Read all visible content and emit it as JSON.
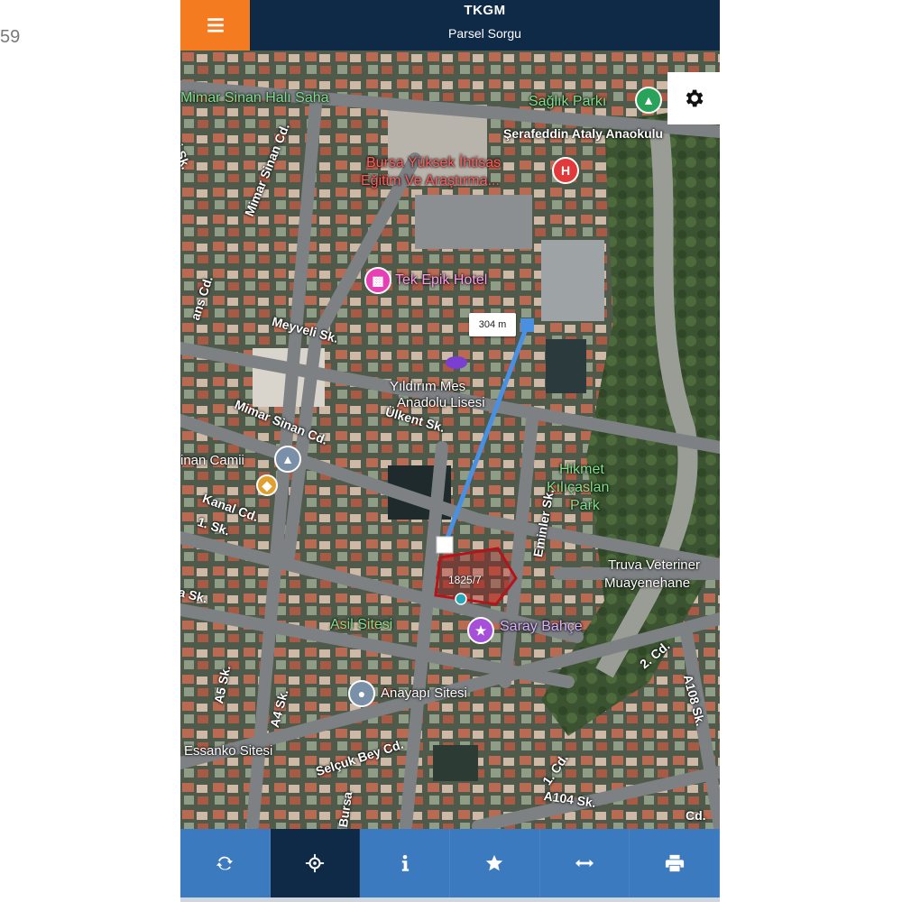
{
  "edge_text": "59",
  "header": {
    "title": "TKGM",
    "subtitle": "Parsel Sorgu"
  },
  "map": {
    "labels": {
      "mimar_halisaha": "Mimar Sinan Halı Saha",
      "saglik_parki": "Sağlık Parkı",
      "anaokulu": "Şerafeddin Ataly Anaokulu",
      "hastane1": "Bursa Yüksek İhtisas",
      "hastane2": "Eğitim Ve Araştırma...",
      "mimar_sinan_cd_v": "Mimar Sinan Cd.",
      "ci_sk": "ci Sk.",
      "hotel": "Tek Epik Hotel",
      "meyveli": "Meyveli Sk.",
      "yildirim1": "Yıldırım Mes",
      "yildirim2": "Anadolu Lisesi",
      "ulukent": "Ülkent Sk.",
      "mimar_sinan_cd": "Mimar Sinan Cd.",
      "cami": "inan Camii",
      "kanal_cd": "Kanal Cd.",
      "one_sk": "1. Sk.",
      "a_sk": "a Sk.",
      "hikmet1": "Hikmet",
      "hikmet2": "Kılıçaslan",
      "hikmet3": "Park",
      "truva1": "Truva Veteriner",
      "truva2": "Muayenehane",
      "asil": "Asil Sitesi",
      "saray": "Saray Bahçe",
      "anayapi": "Anayapı Sitesi",
      "essanko": "Essanko Sitesi",
      "selcuk": "Selçuk Bey Cd.",
      "two_cd": "2. Cd.",
      "a108": "A108 Sk.",
      "a104": "A104 Sk.",
      "one_cd": "1. Cd.",
      "a4": "A4 Sk.",
      "a5": "A5 Sk.",
      "bursa_v": "Bursa",
      "eminler": "Eminler Sk.",
      "enis": "ans Cd.",
      "ucd": "Cd."
    },
    "distance": "304 m",
    "parcel": "1825/7",
    "colors": {
      "route": "#4a90e2",
      "parcel": "#b3151b",
      "hospital": "#e23a3a",
      "hotel": "#e83fb5",
      "park": "#2aa35a",
      "mosque": "#7a8fa8",
      "venue": "#a64fd9"
    }
  },
  "toolbar": {
    "items": [
      {
        "name": "refresh-icon"
      },
      {
        "name": "locate-icon",
        "active": true
      },
      {
        "name": "info-icon"
      },
      {
        "name": "star-icon"
      },
      {
        "name": "measure-icon"
      },
      {
        "name": "print-icon"
      }
    ]
  }
}
